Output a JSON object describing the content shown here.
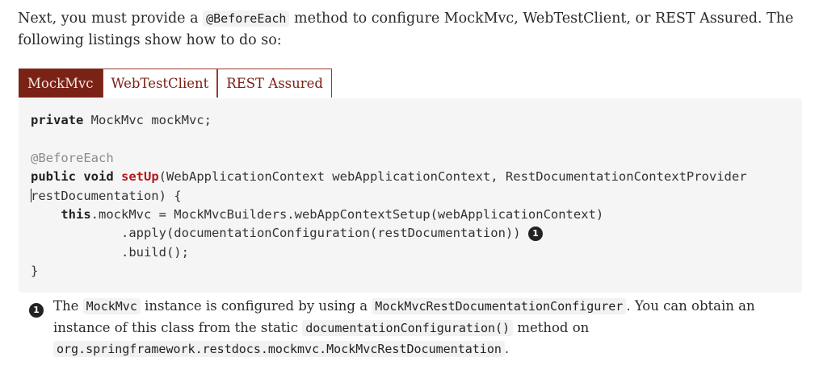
{
  "intro": {
    "part1": "Next, you must provide a ",
    "code": "@BeforeEach",
    "part2": " method to configure MockMvc, WebTestClient, or REST Assured. The following listings show how to do so:"
  },
  "tabs": [
    {
      "label": "MockMvc",
      "active": true
    },
    {
      "label": "WebTestClient",
      "active": false
    },
    {
      "label": "REST Assured",
      "active": false
    }
  ],
  "code": {
    "l1_kw": "private",
    "l1_rest": " MockMvc mockMvc;",
    "l3_ann": "@BeforeEach",
    "l4_kw": "public void",
    "l4_fn": "setUp",
    "l4_rest": "(WebApplicationContext webApplicationContext, RestDocumentationContextProvider",
    "l5": "restDocumentation) {",
    "l6_indent": "    ",
    "l6_kw": "this",
    "l6_rest": ".mockMvc = MockMvcBuilders.webAppContextSetup(webApplicationContext)",
    "l7": "            .apply(documentationConfiguration(restDocumentation)) ",
    "l8": "            .build();",
    "l9": "}",
    "callout": "1"
  },
  "colist": {
    "num": "1",
    "t1": "The ",
    "c1": "MockMvc",
    "t2": " instance is configured by using a ",
    "c2": "MockMvcRestDocumentationConfigurer",
    "t3": ". You can obtain an instance of this class from the static ",
    "c3": "documentationConfiguration()",
    "t4": " method on ",
    "c4": "org.springframework.restdocs.mockmvc.MockMvcRestDocumentation",
    "t5": "."
  }
}
